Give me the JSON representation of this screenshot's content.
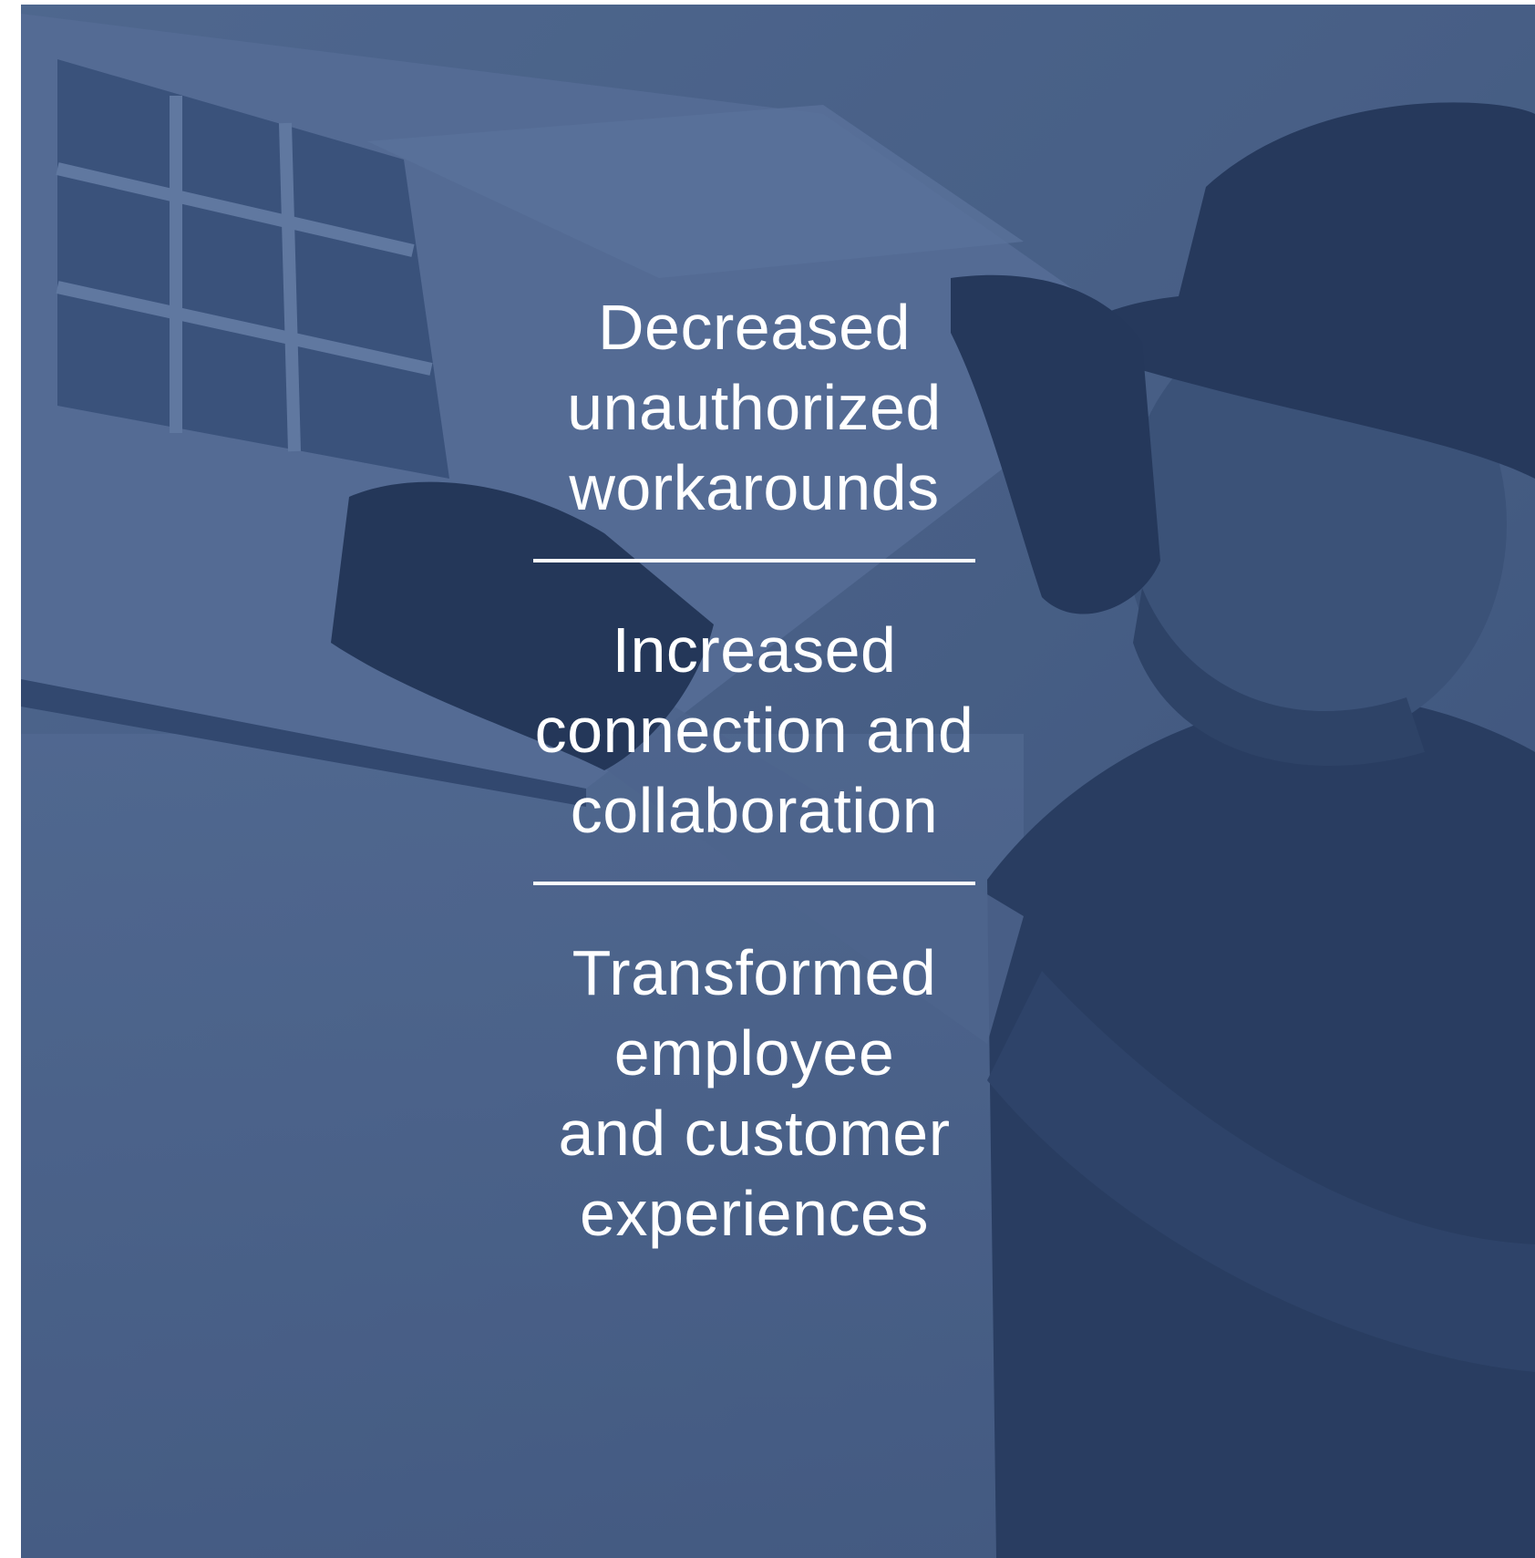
{
  "colors": {
    "overlay": "#3a5682",
    "text": "#ffffff",
    "divider": "#ffffff"
  },
  "background_image": "technician-installing-air-conditioner-photo",
  "stats": [
    {
      "text": "Decreased\nunauthorized\nworkarounds"
    },
    {
      "text": "Increased\nconnection and\ncollaboration"
    },
    {
      "text": "Transformed\nemployee\nand customer\nexperiences"
    }
  ]
}
